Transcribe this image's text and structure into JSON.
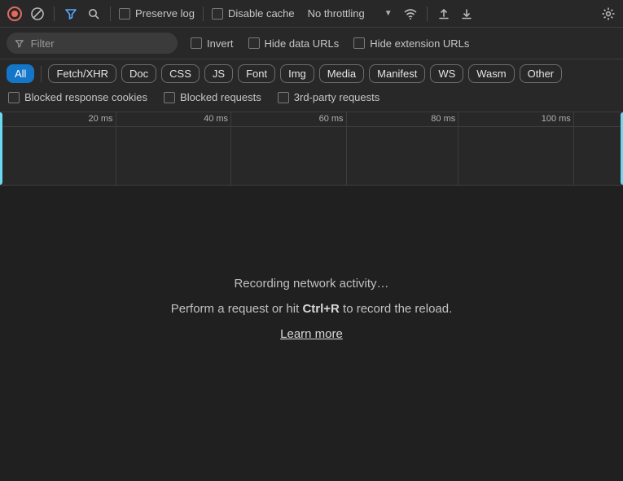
{
  "toolbar": {
    "preserve_log": "Preserve log",
    "disable_cache": "Disable cache",
    "throttling_value": "No throttling"
  },
  "filterbar": {
    "placeholder": "Filter",
    "invert": "Invert",
    "hide_data_urls": "Hide data URLs",
    "hide_ext_urls": "Hide extension URLs"
  },
  "chips": {
    "all": "All",
    "fetchxhr": "Fetch/XHR",
    "doc": "Doc",
    "css": "CSS",
    "js": "JS",
    "font": "Font",
    "img": "Img",
    "media": "Media",
    "manifest": "Manifest",
    "ws": "WS",
    "wasm": "Wasm",
    "other": "Other"
  },
  "extra_filters": {
    "blocked_cookies": "Blocked response cookies",
    "blocked_requests": "Blocked requests",
    "third_party": "3rd-party requests"
  },
  "timeline": {
    "ticks": [
      "20 ms",
      "40 ms",
      "60 ms",
      "80 ms",
      "100 ms"
    ]
  },
  "empty": {
    "title": "Recording network activity…",
    "subtitle_pre": "Perform a request or hit ",
    "shortcut": "Ctrl+R",
    "subtitle_post": " to record the reload.",
    "learn_more": "Learn more"
  }
}
